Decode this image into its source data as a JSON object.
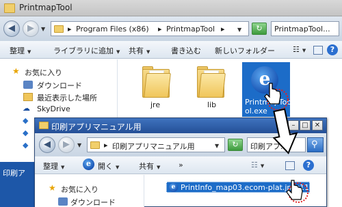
{
  "back_window": {
    "title": "PrintmapTool",
    "address_segments": [
      "Program Files (x86)",
      "PrintmapTool"
    ],
    "search_placeholder": "PrintmapTool...",
    "toolbar": {
      "organize": "整理",
      "add_to_library": "ライブラリに追加",
      "share": "共有",
      "burn": "書き込む",
      "new_folder": "新しいフォルダー"
    },
    "nav": {
      "favorites": "お気に入り",
      "downloads": "ダウンロード",
      "recent_places": "最近表示した場所",
      "skydrive": "SkyDrive"
    },
    "files": [
      {
        "name": "jre",
        "type": "folder"
      },
      {
        "name": "lib",
        "type": "folder"
      },
      {
        "name": "Printmap_Tool.exe",
        "display": "PrintmapToo\nol.exe",
        "type": "exe"
      }
    ],
    "status_text": "印刷ア"
  },
  "front_window": {
    "title": "印刷アプリマニュアル用",
    "address_segment": "印刷アプリマニュアル用",
    "search_placeholder": "印刷アプ...",
    "toolbar": {
      "organize": "整理",
      "open": "開く",
      "share": "共有",
      "more": "»"
    },
    "nav": {
      "favorites": "お気に入り",
      "downloads": "ダウンロード"
    },
    "selected_file": "PrintInfo_map03.ecom-plat.jp_c11.ept"
  },
  "colors": {
    "selection": "#1c6cc8",
    "titlebar_active": "#244f96",
    "highlight_ring": "#e02020"
  },
  "icons": {
    "back": "◀",
    "forward": "▶",
    "caret": "▼",
    "refresh": "↻",
    "search": "⚲",
    "help": "?",
    "minimize": "–",
    "maximize": "□",
    "close": "✕"
  }
}
